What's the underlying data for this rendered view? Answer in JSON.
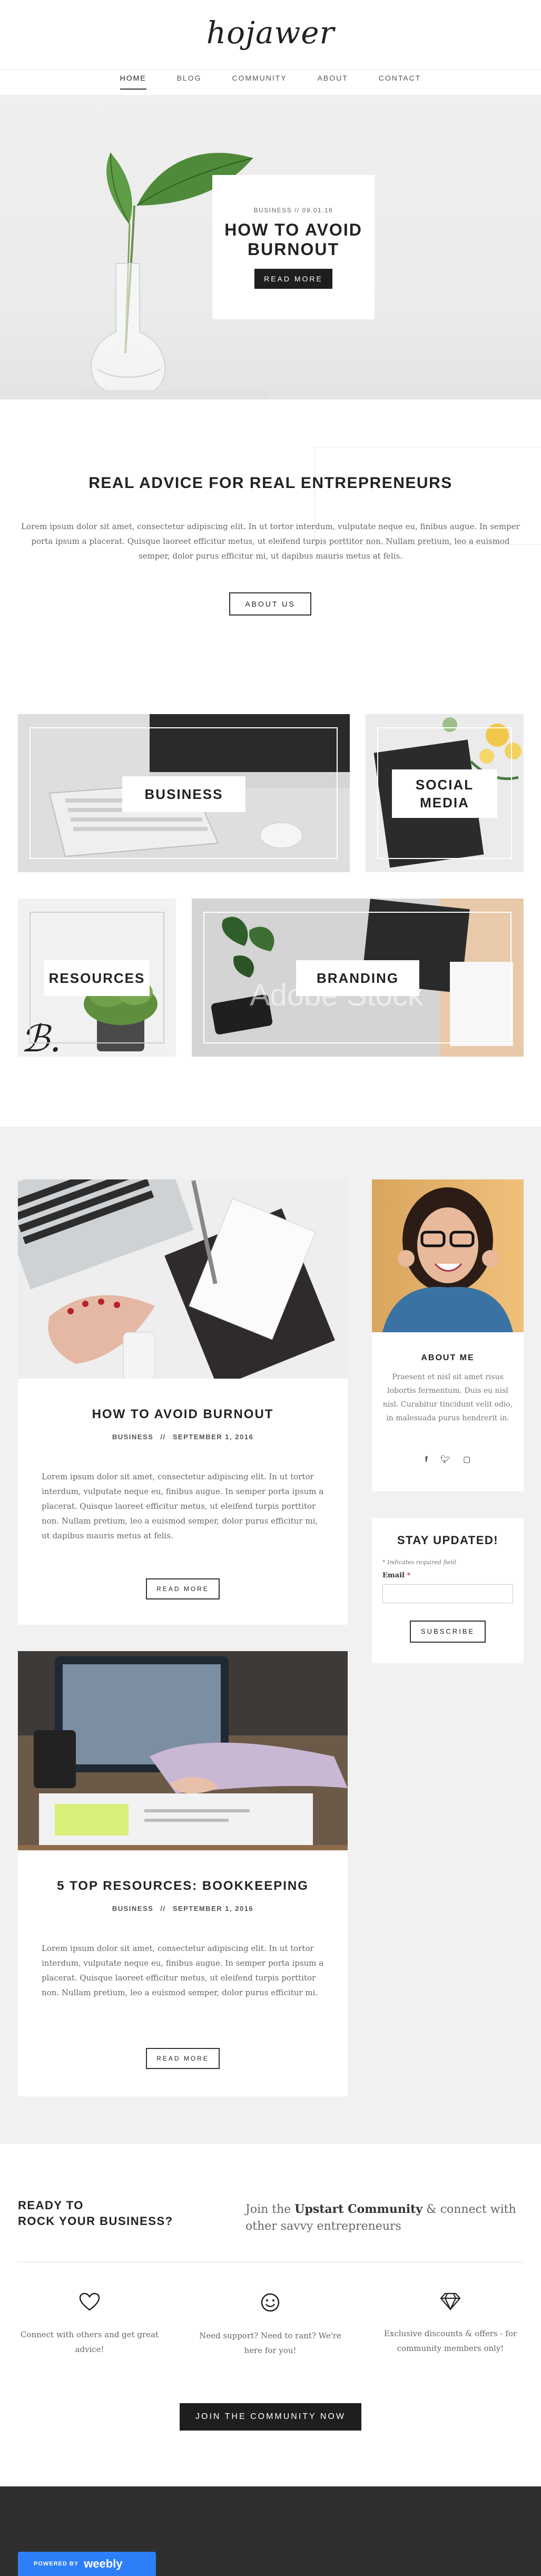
{
  "site": {
    "logo": "hojawer"
  },
  "nav": {
    "items": [
      "HOME",
      "BLOG",
      "COMMUNITY",
      "ABOUT",
      "CONTACT"
    ],
    "active": "HOME"
  },
  "hero": {
    "meta": "BUSINESS  //  09.01.16",
    "title_line1": "HOW TO AVOID",
    "title_line2": "BURNOUT",
    "button": "READ MORE"
  },
  "intro": {
    "heading": "REAL ADVICE FOR REAL ENTREPRENEURS",
    "body": "Lorem ipsum dolor sit amet, consectetur adipiscing elit. In ut tortor interdum, vulputate neque eu, finibus augue. In semper porta ipsum a placerat. Quisque laoreet efficitur metus, ut eleifend turpis porttitor non. Nullam pretium, leo a euismod semper, dolor purus efficitur mi, ut dapibus mauris metus at felis.",
    "button": "ABOUT US"
  },
  "categories": {
    "business": "BUSINESS",
    "social_line1": "SOCIAL",
    "social_line2": "MEDIA",
    "resources": "RESOURCES",
    "branding": "BRANDING",
    "watermark": "Adobe Stock"
  },
  "posts": [
    {
      "title": "HOW TO AVOID BURNOUT",
      "category": "BUSINESS",
      "date": "SEPTEMBER 1, 2016",
      "sep": "//",
      "body": "Lorem ipsum dolor sit amet, consectetur adipiscing elit. In ut tortor interdum, vulputate neque eu, finibus augue. In semper porta ipsum a placerat. Quisque laoreet efficitur metus, ut eleifend turpis porttitor non. Nullam pretium, leo a euismod semper, dolor purus efficitur mi, ut dapibus mauris metus at felis.",
      "button": "READ MORE"
    },
    {
      "title": "5 TOP RESOURCES: BOOKKEEPING",
      "category": "BUSINESS",
      "date": "SEPTEMBER 1, 2016",
      "sep": "//",
      "body": "Lorem ipsum dolor sit amet, consectetur adipiscing elit. In ut tortor interdum, vulputate neque eu, finibus augue. In semper porta ipsum a placerat. Quisque laoreet efficitur metus, ut eleifend turpis porttitor non. Nullam pretium, leo a euismod semper, dolor purus efficitur mi.",
      "button": "READ MORE"
    }
  ],
  "about": {
    "heading": "ABOUT ME",
    "body": "Praesent et nisl sit amet risus lobortis fermentum. Duis eu nisl nisl. Curabitur tincidunt velit odio, in malesuada purus hendrerit in.",
    "social_icons": [
      "facebook-icon",
      "twitter-icon",
      "instagram-icon"
    ]
  },
  "newsletter": {
    "heading": "STAY UPDATED!",
    "required_note": "* Indicates required field",
    "email_label": "Email",
    "required_mark": "*",
    "button": "SUBSCRIBE"
  },
  "cta": {
    "heading_line1": "READY TO",
    "heading_line2": "ROCK YOUR BUSINESS?",
    "text_pre": "Join the ",
    "text_strong": "Upstart Community",
    "text_post": " & connect with other savvy entrepreneurs",
    "features": [
      {
        "icon": "heart-icon",
        "text": "Connect with others and get great advice!"
      },
      {
        "icon": "smiley-icon",
        "text": "Need support? Need to rant? We're here for you!"
      },
      {
        "icon": "diamond-icon",
        "text": "Exclusive discounts & offers - for community members only!"
      }
    ],
    "button": "JOIN THE COMMUNITY NOW"
  },
  "footer": {
    "powered_by": "POWERED BY",
    "brand": "weebly"
  },
  "colors": {
    "accent_dark": "#1e1e1e",
    "gray_section": "#f1f1f1",
    "weebly_blue": "#2d7ff9",
    "footer_dark": "#2f2f2f"
  }
}
